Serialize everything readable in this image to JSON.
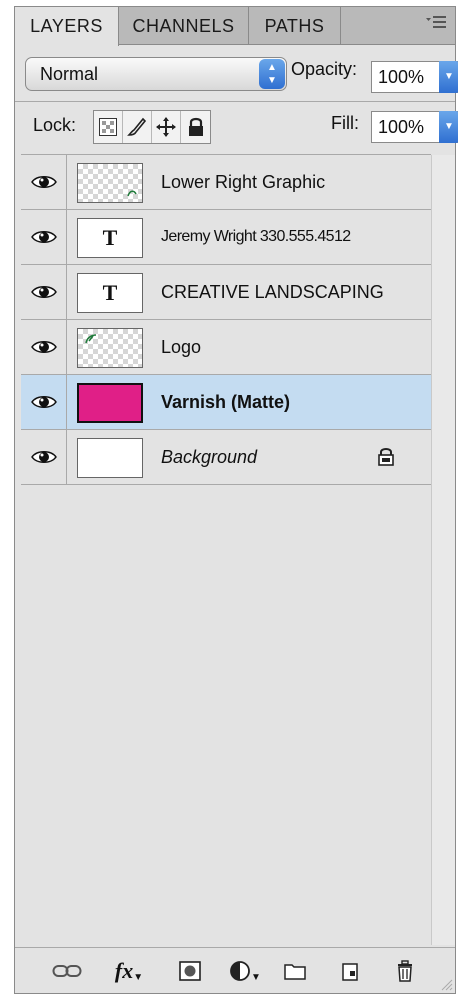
{
  "tabs": [
    {
      "label": "LAYERS",
      "active": true
    },
    {
      "label": "CHANNELS",
      "active": false
    },
    {
      "label": "PATHS",
      "active": false
    }
  ],
  "panel_menu_icon": "panel-menu-icon",
  "blend_mode": {
    "value": "Normal"
  },
  "opacity": {
    "label": "Opacity:",
    "value": "100%"
  },
  "lock": {
    "label": "Lock:",
    "buttons": [
      "lock-transparent-pixels-icon",
      "lock-image-pixels-icon",
      "lock-position-icon",
      "lock-all-icon"
    ]
  },
  "fill": {
    "label": "Fill:",
    "value": "100%"
  },
  "layers": [
    {
      "name": "Lower Right Graphic",
      "thumb": "checker",
      "visible": true,
      "selected": false
    },
    {
      "name": "Jeremy Wright 330.555.4512",
      "thumb": "text",
      "thumb_glyph": "T",
      "visible": true,
      "selected": false
    },
    {
      "name": "CREATIVE LANDSCAPING",
      "thumb": "text",
      "thumb_glyph": "T",
      "visible": true,
      "selected": false
    },
    {
      "name": "Logo",
      "thumb": "checker",
      "visible": true,
      "selected": false
    },
    {
      "name": "Varnish (Matte)",
      "thumb": "fill",
      "thumb_color": "#e01f87",
      "visible": true,
      "selected": true
    },
    {
      "name": "Background",
      "thumb": "white",
      "visible": true,
      "selected": false,
      "locked": true
    }
  ],
  "toolbar": {
    "fx_label": "fx",
    "icons": [
      "link-layers-icon",
      "layer-style-icon",
      "add-mask-icon",
      "adjustment-layer-icon",
      "new-group-icon",
      "new-layer-icon",
      "delete-layer-icon"
    ]
  },
  "colors": {
    "panel_bg": "#e3e3e3",
    "selected_row": "#c4dcf1",
    "accent_blue": "#2f6fd1",
    "varnish_magenta": "#e01f87"
  }
}
